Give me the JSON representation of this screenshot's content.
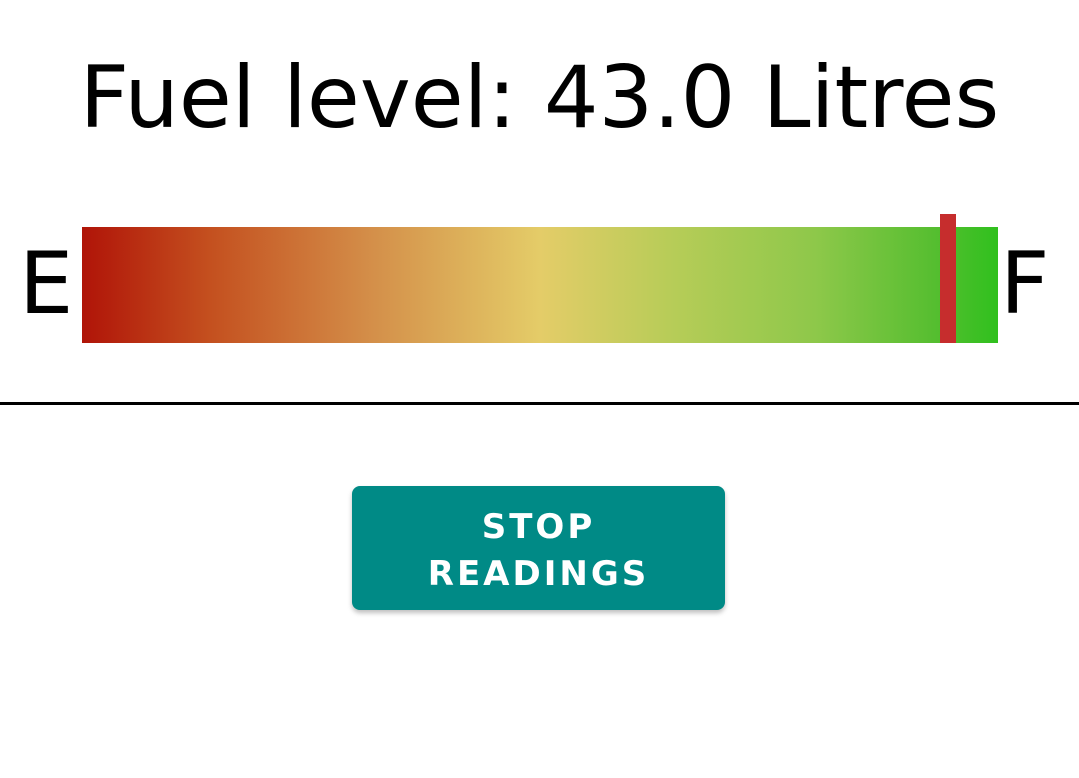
{
  "header": {
    "title": "Fuel level: 43.0 Litres"
  },
  "gauge": {
    "empty_label": "E",
    "full_label": "F",
    "level_fraction": 0.945,
    "gradient_colors": [
      "#b01408",
      "#e4cc68",
      "#30c01e"
    ],
    "needle_color": "#c62d2d"
  },
  "controls": {
    "stop_button_line1": "STOP",
    "stop_button_line2": "READINGS",
    "button_color": "#008a86"
  }
}
